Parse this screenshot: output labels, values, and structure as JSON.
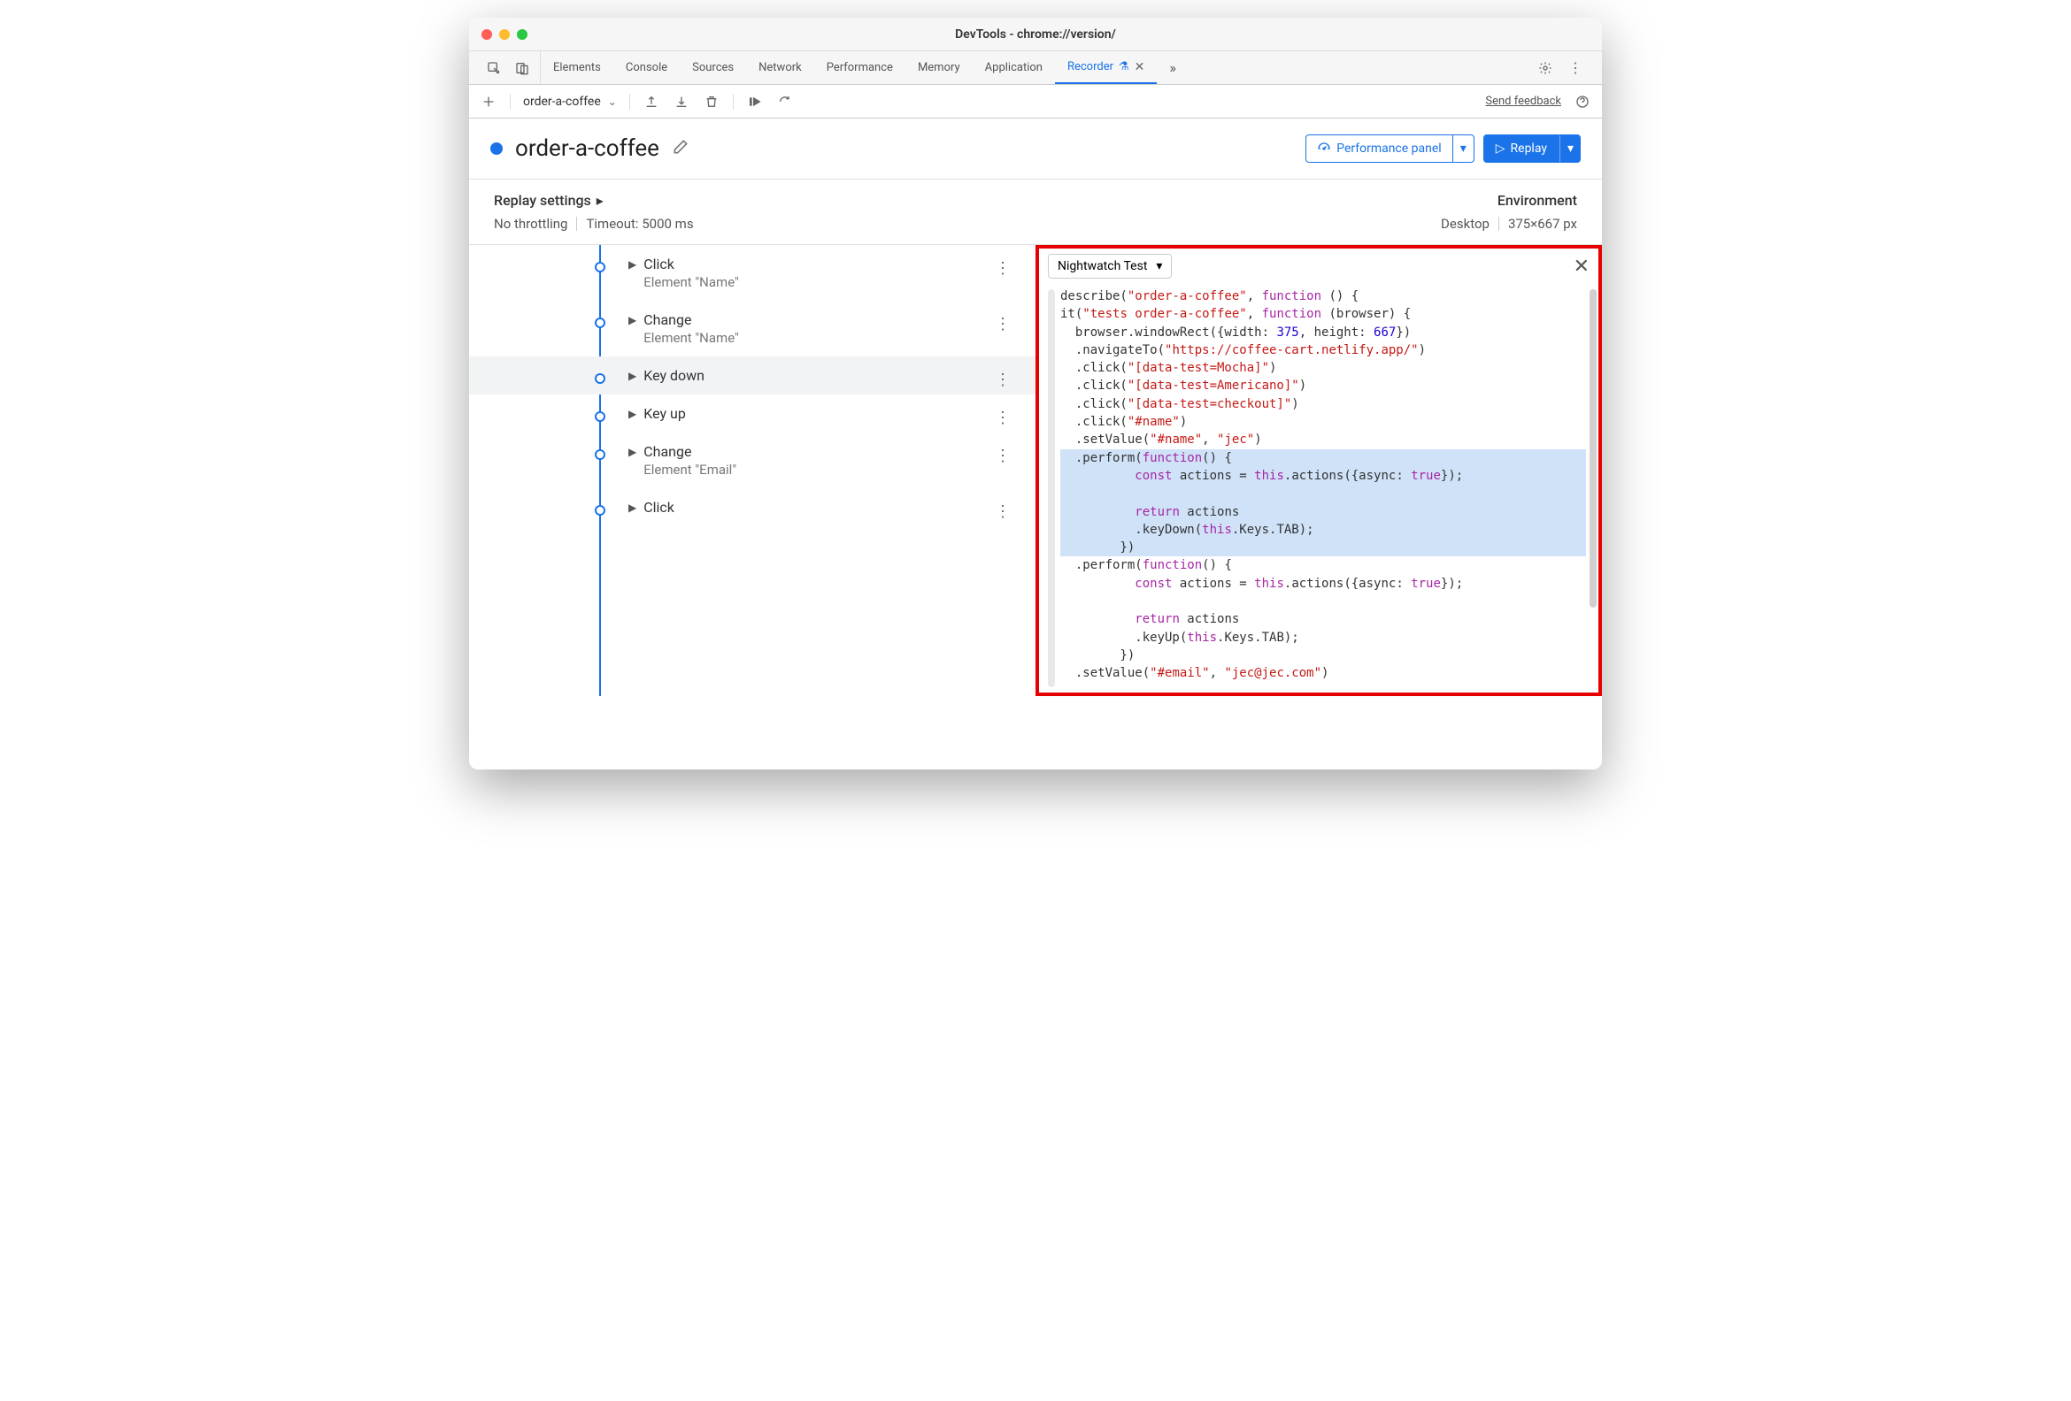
{
  "window": {
    "title": "DevTools - chrome://version/"
  },
  "tabs": {
    "items": [
      "Elements",
      "Console",
      "Sources",
      "Network",
      "Performance",
      "Memory",
      "Application"
    ],
    "active": "Recorder"
  },
  "toolbar": {
    "recording_name": "order-a-coffee",
    "feedback_label": "Send feedback"
  },
  "header": {
    "title": "order-a-coffee",
    "perf_button": "Performance panel",
    "replay_button": "Replay"
  },
  "settings": {
    "section_label": "Replay settings",
    "throttling": "No throttling",
    "timeout": "Timeout: 5000 ms",
    "env_label": "Environment",
    "env_device": "Desktop",
    "env_size": "375×667 px"
  },
  "steps": [
    {
      "title": "Click",
      "sub": "Element \"Name\""
    },
    {
      "title": "Change",
      "sub": "Element \"Name\""
    },
    {
      "title": "Key down",
      "sub": ""
    },
    {
      "title": "Key up",
      "sub": ""
    },
    {
      "title": "Change",
      "sub": "Element \"Email\""
    },
    {
      "title": "Click",
      "sub": ""
    }
  ],
  "code_dropdown": "Nightwatch Test",
  "code": {
    "l1_a": "describe(",
    "l1_b": "\"order-a-coffee\"",
    "l1_c": ", ",
    "l1_d": "function",
    "l1_e": " () {",
    "l2_a": "it(",
    "l2_b": "\"tests order-a-coffee\"",
    "l2_c": ", ",
    "l2_d": "function",
    "l2_e": " (browser) {",
    "l3_a": "  browser.windowRect({width: ",
    "l3_b": "375",
    "l3_c": ", height: ",
    "l3_d": "667",
    "l3_e": "})",
    "l4_a": "  .navigateTo(",
    "l4_b": "\"https://coffee-cart.netlify.app/\"",
    "l4_c": ")",
    "l5_a": "  .click(",
    "l5_b": "\"[data-test=Mocha]\"",
    "l5_c": ")",
    "l6_a": "  .click(",
    "l6_b": "\"[data-test=Americano]\"",
    "l6_c": ")",
    "l7_a": "  .click(",
    "l7_b": "\"[data-test=checkout]\"",
    "l7_c": ")",
    "l8_a": "  .click(",
    "l8_b": "\"#name\"",
    "l8_c": ")",
    "l9_a": "  .setValue(",
    "l9_b": "\"#name\"",
    "l9_c": ", ",
    "l9_d": "\"jec\"",
    "l9_e": ")",
    "l10_a": "  .perform(",
    "l10_b": "function",
    "l10_c": "() {",
    "l11_a": "          ",
    "l11_b": "const",
    "l11_c": " actions = ",
    "l11_d": "this",
    "l11_e": ".actions({async: ",
    "l11_f": "true",
    "l11_g": "});",
    "l12": "",
    "l13_a": "          ",
    "l13_b": "return",
    "l13_c": " actions",
    "l14_a": "          .keyDown(",
    "l14_b": "this",
    "l14_c": ".Keys.TAB);",
    "l15": "        })",
    "l16_a": "  .perform(",
    "l16_b": "function",
    "l16_c": "() {",
    "l17_a": "          ",
    "l17_b": "const",
    "l17_c": " actions = ",
    "l17_d": "this",
    "l17_e": ".actions({async: ",
    "l17_f": "true",
    "l17_g": "});",
    "l18": "",
    "l19_a": "          ",
    "l19_b": "return",
    "l19_c": " actions",
    "l20_a": "          .keyUp(",
    "l20_b": "this",
    "l20_c": ".Keys.TAB);",
    "l21": "        })",
    "l22_a": "  .setValue(",
    "l22_b": "\"#email\"",
    "l22_c": ", ",
    "l22_d": "\"jec@jec.com\"",
    "l22_e": ")"
  }
}
